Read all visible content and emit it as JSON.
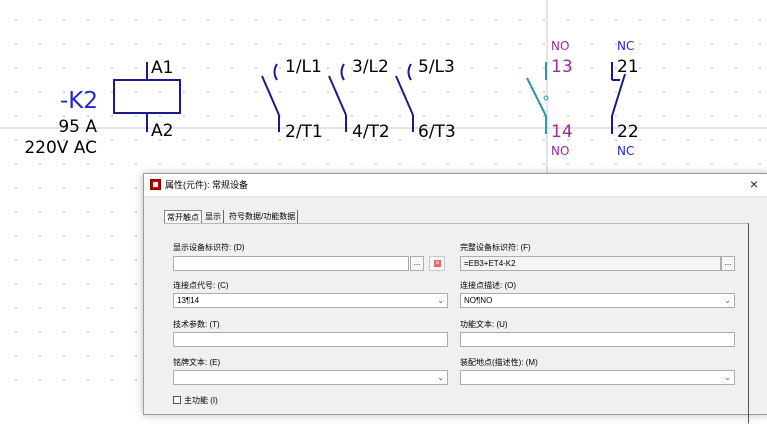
{
  "schematic": {
    "device_tag": "-K2",
    "current": "95 A",
    "voltage": "220V AC",
    "coil_terminals": {
      "top": "A1",
      "bottom": "A2"
    },
    "main_contacts": [
      {
        "top": "1/L1",
        "bottom": "2/T1"
      },
      {
        "top": "3/L2",
        "bottom": "4/T2"
      },
      {
        "top": "5/L3",
        "bottom": "6/T3"
      }
    ],
    "aux_contacts": [
      {
        "type_top": "NO",
        "top": "13",
        "bottom": "14",
        "type_bottom": "NO"
      },
      {
        "type_top": "NC",
        "top": "21",
        "bottom": "22",
        "type_bottom": "NC"
      }
    ],
    "colors": {
      "tag": "#2626c8",
      "contact_type": "#9b2a9b",
      "selected_contact": "#2a9aa8",
      "wire": "#1a1a8c"
    }
  },
  "dialog": {
    "title": "属性(元件): 常规设备",
    "close_label": "×",
    "tabs": [
      "常开触点",
      "显示",
      "符号数据/功能数据"
    ],
    "fields": {
      "display_device_tag": {
        "label": "显示设备标识符: (D)",
        "value": ""
      },
      "full_device_tag": {
        "label": "完整设备标识符: (F)",
        "value": "=EB3+ET4-K2"
      },
      "connection_point_code": {
        "label": "连接点代号: (C)",
        "value": "13¶14"
      },
      "connection_point_desc": {
        "label": "连接点描述: (O)",
        "value": "NO¶NO"
      },
      "technical_params": {
        "label": "技术参数: (T)",
        "value": ""
      },
      "function_text": {
        "label": "功能文本: (U)",
        "value": ""
      },
      "nameplate_text": {
        "label": "铭牌文本: (E)",
        "value": ""
      },
      "mounting_location": {
        "label": "装配地点(描述性): (M)",
        "value": ""
      }
    },
    "browse_label": "...",
    "checkbox_label": "主功能 (I)"
  }
}
